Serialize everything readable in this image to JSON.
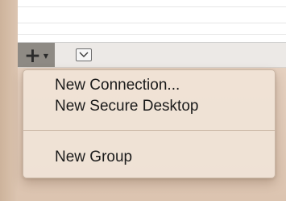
{
  "toolbar": {
    "add_button_icon": "plus-icon",
    "add_menu_indicator_icon": "chevron-down-icon",
    "view_options_icon": "dropdown-box-icon"
  },
  "menu": {
    "items": [
      {
        "label": "New Connection..."
      },
      {
        "label": "New Secure Desktop"
      },
      {
        "label": "New Group"
      }
    ]
  },
  "colors": {
    "menu_background": "#f0e2d6",
    "toolbar_button_pressed": "#8e8a84",
    "text": "#1a1a1a"
  }
}
